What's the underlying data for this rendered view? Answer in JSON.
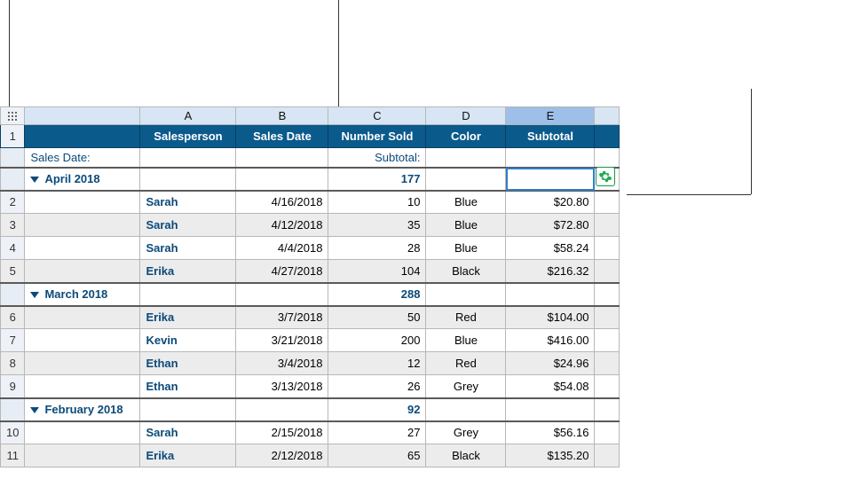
{
  "columns": {
    "A": "A",
    "B": "B",
    "C": "C",
    "D": "D",
    "E": "E"
  },
  "headers": {
    "salesperson": "Salesperson",
    "salesdate": "Sales Date",
    "numbersold": "Number Sold",
    "color": "Color",
    "subtotal": "Subtotal"
  },
  "summary_labels": {
    "sales_date": "Sales Date:",
    "subtotal": "Subtotal:"
  },
  "rownums": {
    "r1": "1",
    "r2": "2",
    "r3": "3",
    "r4": "4",
    "r5": "5",
    "r6": "6",
    "r7": "7",
    "r8": "8",
    "r9": "9",
    "r10": "10",
    "r11": "11"
  },
  "groups": [
    {
      "label": "April 2018",
      "number_sold": "177",
      "selected": true,
      "rows": [
        {
          "n": "2",
          "name": "Sarah",
          "date": "4/16/2018",
          "num": "10",
          "color": "Blue",
          "money": "$20.80",
          "alt": false
        },
        {
          "n": "3",
          "name": "Sarah",
          "date": "4/12/2018",
          "num": "35",
          "color": "Blue",
          "money": "$72.80",
          "alt": true
        },
        {
          "n": "4",
          "name": "Sarah",
          "date": "4/4/2018",
          "num": "28",
          "color": "Blue",
          "money": "$58.24",
          "alt": false
        },
        {
          "n": "5",
          "name": "Erika",
          "date": "4/27/2018",
          "num": "104",
          "color": "Black",
          "money": "$216.32",
          "alt": true
        }
      ]
    },
    {
      "label": "March 2018",
      "number_sold": "288",
      "rows": [
        {
          "n": "6",
          "name": "Erika",
          "date": "3/7/2018",
          "num": "50",
          "color": "Red",
          "money": "$104.00",
          "alt": true
        },
        {
          "n": "7",
          "name": "Kevin",
          "date": "3/21/2018",
          "num": "200",
          "color": "Blue",
          "money": "$416.00",
          "alt": false
        },
        {
          "n": "8",
          "name": "Ethan",
          "date": "3/4/2018",
          "num": "12",
          "color": "Red",
          "money": "$24.96",
          "alt": true
        },
        {
          "n": "9",
          "name": "Ethan",
          "date": "3/13/2018",
          "num": "26",
          "color": "Grey",
          "money": "$54.08",
          "alt": false
        }
      ]
    },
    {
      "label": "February 2018",
      "number_sold": "92",
      "rows": [
        {
          "n": "10",
          "name": "Sarah",
          "date": "2/15/2018",
          "num": "27",
          "color": "Grey",
          "money": "$56.16",
          "alt": false
        },
        {
          "n": "11",
          "name": "Erika",
          "date": "2/12/2018",
          "num": "65",
          "color": "Black",
          "money": "$135.20",
          "alt": true
        }
      ]
    }
  ]
}
